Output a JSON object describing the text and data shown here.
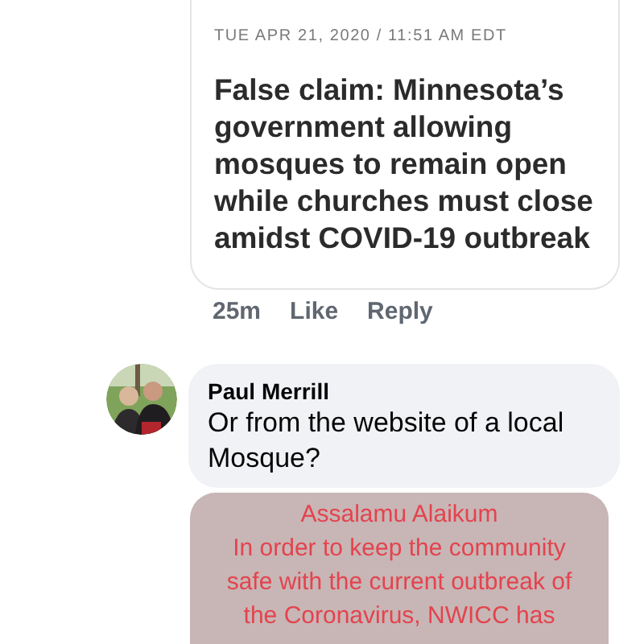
{
  "shared_article": {
    "date": "TUE APR 21, 2020 / 11:51 AM EDT",
    "headline": "False claim: Minnesota’s government allowing mosques to remain open while churches must close amidst COVID-19 outbreak"
  },
  "actions": [
    "25m",
    "Like",
    "Reply"
  ],
  "reply": {
    "author": "Paul Merrill",
    "text": "Or from the website of a local Mosque?"
  },
  "attached_image": {
    "lines": [
      "Assalamu Alaikum",
      "In order to keep the community",
      "safe with the current outbreak of",
      "the Coronavirus, NWICC has"
    ]
  }
}
